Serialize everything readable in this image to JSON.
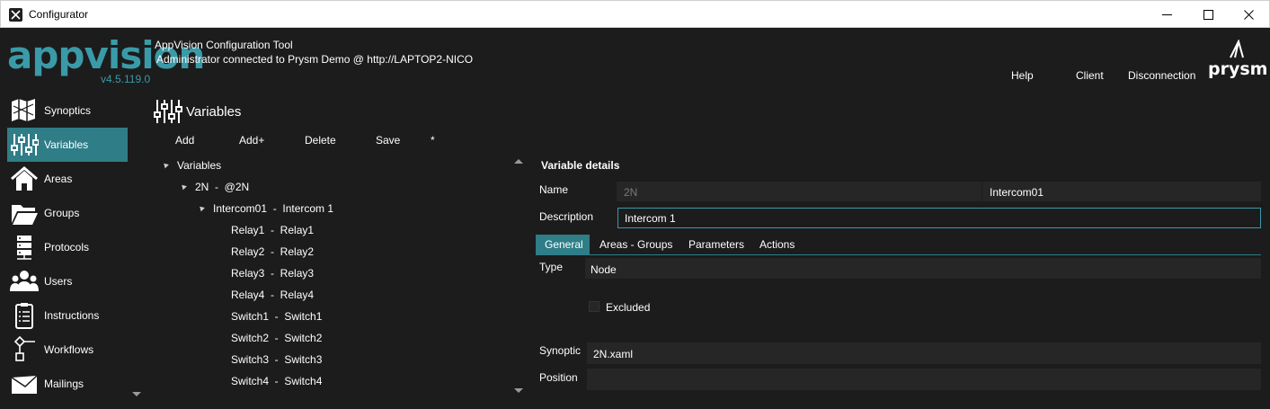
{
  "window": {
    "title": "Configurator",
    "minimize_icon": "minimize-icon",
    "maximize_icon": "maximize-icon",
    "close_icon": "close-icon"
  },
  "header": {
    "logo_text": "appvision",
    "version": "v4.5.119.0",
    "tool_title": "AppVision Configuration Tool",
    "connection_status": "Administrator connected to Prysm Demo @ http://LAPTOP2-NICO",
    "links": {
      "help": "Help",
      "client": "Client",
      "disconnection": "Disconnection"
    },
    "brand_logo": "prysm"
  },
  "sidebar": {
    "items": [
      {
        "label": "Synoptics",
        "icon": "map-icon",
        "active": false
      },
      {
        "label": "Variables",
        "icon": "sliders-icon",
        "active": true
      },
      {
        "label": "Areas",
        "icon": "house-icon",
        "active": false
      },
      {
        "label": "Groups",
        "icon": "folder-icon",
        "active": false
      },
      {
        "label": "Protocols",
        "icon": "server-icon",
        "active": false
      },
      {
        "label": "Users",
        "icon": "users-icon",
        "active": false
      },
      {
        "label": "Instructions",
        "icon": "clipboard-icon",
        "active": false
      },
      {
        "label": "Workflows",
        "icon": "workflow-icon",
        "active": false
      },
      {
        "label": "Mailings",
        "icon": "envelope-icon",
        "active": false
      }
    ]
  },
  "variables_pane": {
    "title": "Variables",
    "toolbar": {
      "add": "Add",
      "add_plus": "Add+",
      "delete": "Delete",
      "save": "Save",
      "star": "*"
    },
    "tree": {
      "root": "Variables",
      "server": "2N  -  @2N",
      "device": "Intercom01  -  Intercom 1",
      "children": [
        "Relay1  -  Relay1",
        "Relay2  -  Relay2",
        "Relay3  -  Relay3",
        "Relay4  -  Relay4",
        "Switch1  -  Switch1",
        "Switch2  -  Switch2",
        "Switch3  -  Switch3",
        "Switch4  -  Switch4"
      ]
    }
  },
  "details": {
    "title": "Variable details",
    "name_label": "Name",
    "name_prefix": "2N",
    "name_value": "Intercom01",
    "description_label": "Description",
    "description_value": "Intercom 1",
    "tabs": [
      "General",
      "Areas - Groups",
      "Parameters",
      "Actions"
    ],
    "type_label": "Type",
    "type_value": "Node",
    "excluded_label": "Excluded",
    "synoptic_label": "Synoptic",
    "synoptic_value": "2N.xaml",
    "position_label": "Position",
    "position_value": ""
  },
  "colors": {
    "accent": "#2f7d87",
    "logo": "#3a9aa8",
    "background": "#1c1c1c",
    "field": "#262626",
    "muted_text": "#7a7a7a"
  }
}
